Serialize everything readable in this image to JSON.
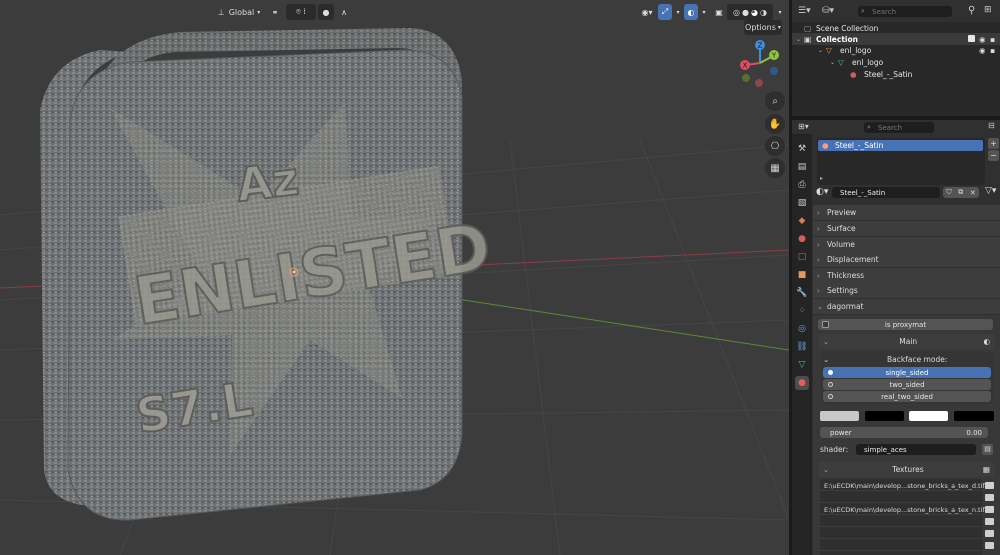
{
  "header": {
    "orientation": "Global",
    "options_label": "Options"
  },
  "gizmo": {
    "x_label": "X",
    "y_label": "Y",
    "z_label": "Z"
  },
  "outliner": {
    "search_placeholder": "Search",
    "rows": [
      {
        "label": "Scene Collection"
      },
      {
        "label": "Collection"
      },
      {
        "label": "enl_logo"
      },
      {
        "label": "enl_logo"
      },
      {
        "label": "Steel_-_Satin"
      }
    ]
  },
  "properties": {
    "search_placeholder": "Search",
    "slot_name": "Steel_-_Satin",
    "material_name": "Steel_-_Satin",
    "panels": [
      "Preview",
      "Surface",
      "Volume",
      "Displacement",
      "Thickness",
      "Settings"
    ],
    "dagormat": {
      "title": "dagormat",
      "is_proxymat": "is proxymat",
      "main_title": "Main",
      "backface_title": "Backface mode:",
      "backface_options": [
        "single_sided",
        "two_sided",
        "real_two_sided"
      ],
      "power_label": "power",
      "power_value": "0.00",
      "shader_label": "shader:",
      "shader_value": "simple_aces",
      "textures_title": "Textures",
      "texture_paths": [
        "E:\\uECDK\\main\\develop...stone_bricks_a_tex_d.tif",
        "E:\\uECDK\\main\\develop...stone_bricks_a_tex_n.tif"
      ],
      "swatch_colors": [
        "#c8c8c8",
        "#000000",
        "#ffffff",
        "#000000"
      ]
    }
  },
  "colors": {
    "accent": "#4772b3",
    "viewport_bg": "#3c3c3c",
    "axis_x": "#e04d5e",
    "axis_y": "#8cc63f",
    "axis_z": "#3a8fe0"
  }
}
